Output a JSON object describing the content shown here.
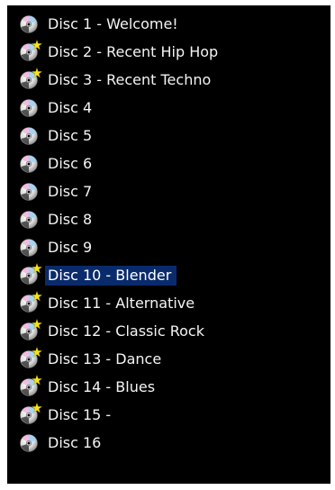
{
  "colors": {
    "panel_background": "#000000",
    "text": "#f4f4f4",
    "selection_background": "#0a2b6b",
    "new_star": "#f5e21a"
  },
  "discs": [
    {
      "label": "Disc 1 - Welcome!",
      "icon": "cd-disc-icon",
      "new": false,
      "selected": false
    },
    {
      "label": "Disc 2 - Recent Hip Hop",
      "icon": "cd-disc-icon",
      "new": true,
      "selected": false
    },
    {
      "label": "Disc 3 - Recent Techno",
      "icon": "cd-disc-icon",
      "new": true,
      "selected": false
    },
    {
      "label": "Disc 4",
      "icon": "cd-disc-icon",
      "new": false,
      "selected": false
    },
    {
      "label": "Disc 5",
      "icon": "cd-disc-icon",
      "new": false,
      "selected": false
    },
    {
      "label": "Disc 6",
      "icon": "cd-disc-icon",
      "new": false,
      "selected": false
    },
    {
      "label": "Disc 7",
      "icon": "cd-disc-icon",
      "new": false,
      "selected": false
    },
    {
      "label": "Disc 8",
      "icon": "cd-disc-icon",
      "new": false,
      "selected": false
    },
    {
      "label": "Disc 9",
      "icon": "cd-disc-icon",
      "new": false,
      "selected": false
    },
    {
      "label": "Disc 10 - Blender",
      "icon": "cd-disc-icon",
      "new": true,
      "selected": true
    },
    {
      "label": "Disc 11 - Alternative",
      "icon": "cd-disc-icon",
      "new": true,
      "selected": false
    },
    {
      "label": "Disc 12 - Classic Rock",
      "icon": "cd-disc-icon",
      "new": true,
      "selected": false
    },
    {
      "label": "Disc 13 - Dance",
      "icon": "cd-disc-icon",
      "new": true,
      "selected": false
    },
    {
      "label": "Disc 14 - Blues",
      "icon": "cd-disc-icon",
      "new": true,
      "selected": false
    },
    {
      "label": "Disc 15 -",
      "icon": "cd-disc-icon",
      "new": true,
      "selected": false
    },
    {
      "label": "Disc 16",
      "icon": "cd-disc-icon",
      "new": false,
      "selected": false
    }
  ]
}
